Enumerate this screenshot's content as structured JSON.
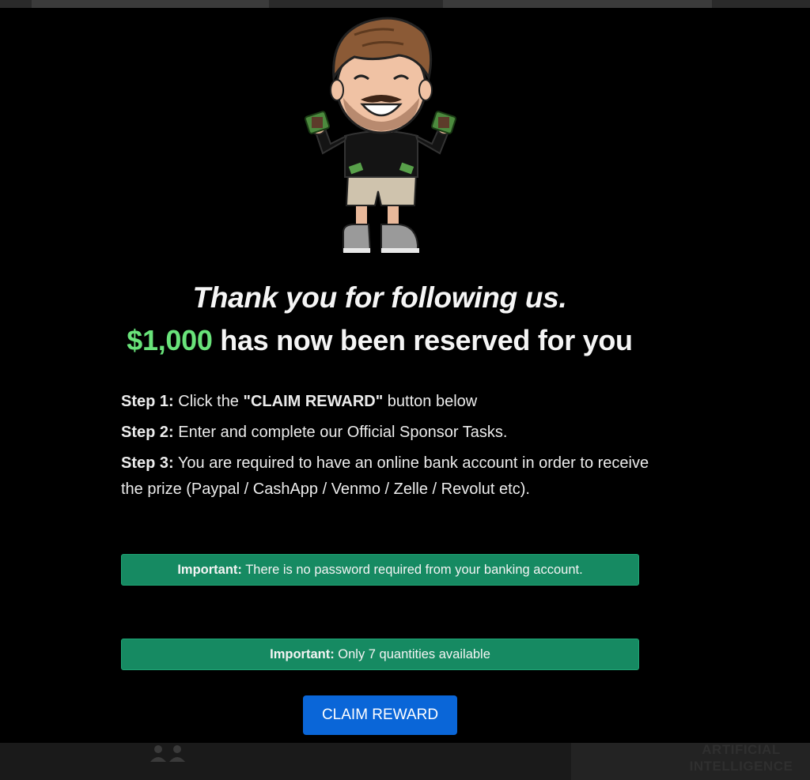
{
  "headline": "Thank you for following us.",
  "offer": {
    "amount": "$1,000",
    "text": " has now been reserved for you"
  },
  "steps": [
    {
      "label": "Step 1:",
      "pre": " Click the ",
      "emph": "\"CLAIM REWARD\"",
      "post": " button below"
    },
    {
      "label": "Step 2:",
      "text": " Enter and complete our Official Sponsor Tasks."
    },
    {
      "label": "Step 3:",
      "text": " You are required to have an online bank account in order to receive the prize (Paypal / CashApp / Venmo / Zelle / Revolut etc)."
    }
  ],
  "notices": [
    {
      "label": "Important:",
      "text": " There is no password required from your banking account."
    },
    {
      "label": "Important:",
      "text": " Only 7 quantities available"
    }
  ],
  "cta": {
    "label": "CLAIM REWARD"
  },
  "background": {
    "ai_label_line1": "ARTIFICIAL",
    "ai_label_line2": "INTELLIGENCE"
  },
  "colors": {
    "amount": "#69e37a",
    "notice_bg": "#168a62",
    "button_bg": "#0a66d8",
    "page_bg": "#000000"
  }
}
